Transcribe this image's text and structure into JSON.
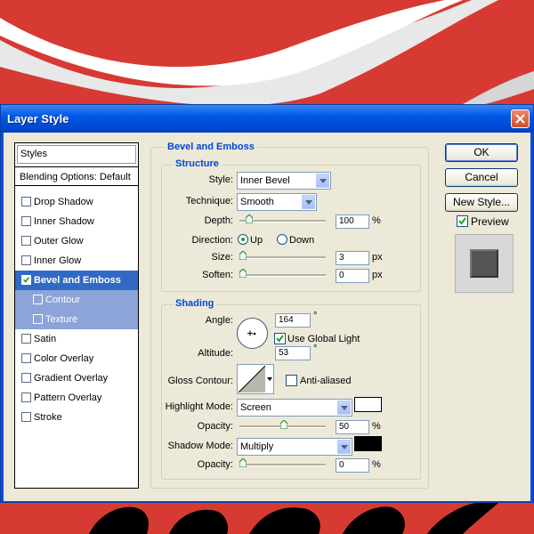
{
  "window": {
    "title": "Layer Style"
  },
  "styles_panel": {
    "header": "Styles",
    "blending": "Blending Options: Default",
    "items": [
      {
        "label": "Drop Shadow",
        "checked": false
      },
      {
        "label": "Inner Shadow",
        "checked": false
      },
      {
        "label": "Outer Glow",
        "checked": false
      },
      {
        "label": "Inner Glow",
        "checked": false
      },
      {
        "label": "Bevel and Emboss",
        "checked": true,
        "selected": true
      },
      {
        "label": "Contour",
        "checked": false,
        "sub": true
      },
      {
        "label": "Texture",
        "checked": false,
        "sub": true
      },
      {
        "label": "Satin",
        "checked": false
      },
      {
        "label": "Color Overlay",
        "checked": false
      },
      {
        "label": "Gradient Overlay",
        "checked": false
      },
      {
        "label": "Pattern Overlay",
        "checked": false
      },
      {
        "label": "Stroke",
        "checked": false
      }
    ]
  },
  "bevel": {
    "title": "Bevel and Emboss",
    "structure": {
      "title": "Structure",
      "style_label": "Style:",
      "style_value": "Inner Bevel",
      "technique_label": "Technique:",
      "technique_value": "Smooth",
      "depth_label": "Depth:",
      "depth_value": "100",
      "depth_unit": "%",
      "direction_label": "Direction:",
      "up_label": "Up",
      "down_label": "Down",
      "size_label": "Size:",
      "size_value": "3",
      "size_unit": "px",
      "soften_label": "Soften:",
      "soften_value": "0",
      "soften_unit": "px"
    },
    "shading": {
      "title": "Shading",
      "angle_label": "Angle:",
      "angle_value": "164",
      "degree": "°",
      "global_light_label": "Use Global Light",
      "altitude_label": "Altitude:",
      "altitude_value": "53",
      "gloss_label": "Gloss Contour:",
      "anti_aliased_label": "Anti-aliased",
      "highlight_label": "Highlight Mode:",
      "highlight_value": "Screen",
      "highlight_opacity_label": "Opacity:",
      "highlight_opacity_value": "50",
      "shadow_label": "Shadow Mode:",
      "shadow_value": "Multiply",
      "shadow_opacity_label": "Opacity:",
      "shadow_opacity_value": "0",
      "percent": "%",
      "highlight_color": "#ffffff",
      "shadow_color": "#000000"
    }
  },
  "buttons": {
    "ok": "OK",
    "cancel": "Cancel",
    "new_style": "New Style...",
    "preview": "Preview"
  }
}
